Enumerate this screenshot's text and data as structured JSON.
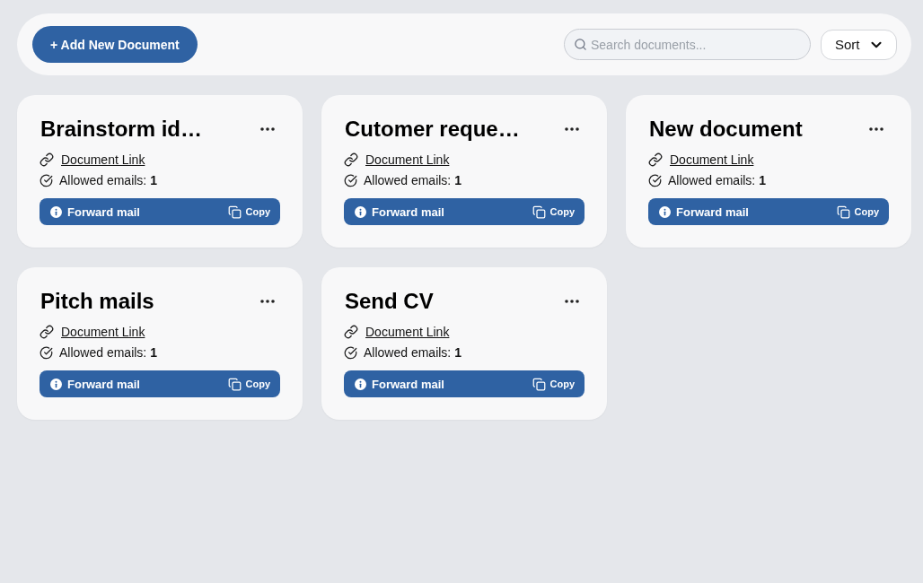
{
  "toolbar": {
    "add_button": "+ Add New Document",
    "search": {
      "placeholder": "Search documents..."
    },
    "sort": {
      "label": "Sort"
    }
  },
  "documents": [
    {
      "title": "Brainstorm id…",
      "link": "Document Link",
      "allowed": "Allowed emails: **1**",
      "forward": "Forward mail",
      "copy": "Copy"
    },
    {
      "title": "Cutomer reque…",
      "link": "Document Link",
      "allowed": "Allowed emails: **1**",
      "forward": "Forward mail",
      "copy": "Copy"
    },
    {
      "title": "New document",
      "link": "Document Link",
      "allowed": "Allowed emails: **1**",
      "forward": "Forward mail",
      "copy": "Copy"
    },
    {
      "title": "Pitch mails",
      "link": "Document Link",
      "allowed": "Allowed emails: **1**",
      "forward": "Forward mail",
      "copy": "Copy"
    },
    {
      "title": "Send CV",
      "link": "Document Link",
      "allowed": "Allowed emails: **1**",
      "forward": "Forward mail",
      "copy": "Copy"
    }
  ]
}
